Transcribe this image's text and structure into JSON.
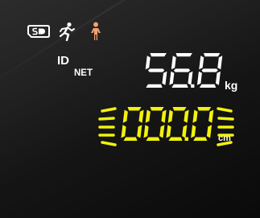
{
  "display": {
    "weight_value": "56.8",
    "weight_unit": "kg",
    "height_value": "000.0",
    "height_unit": "cm",
    "id_label": "ID",
    "net_label": "NET"
  },
  "icons": {
    "sd_card": "sd-card-icon",
    "runner": "runner-icon",
    "person": "person-icon"
  },
  "colors": {
    "background": "#1a1a1a",
    "weight_digits": "#ffffff",
    "height_digits": "#f2f20c",
    "person_icon": "#f2a070"
  }
}
